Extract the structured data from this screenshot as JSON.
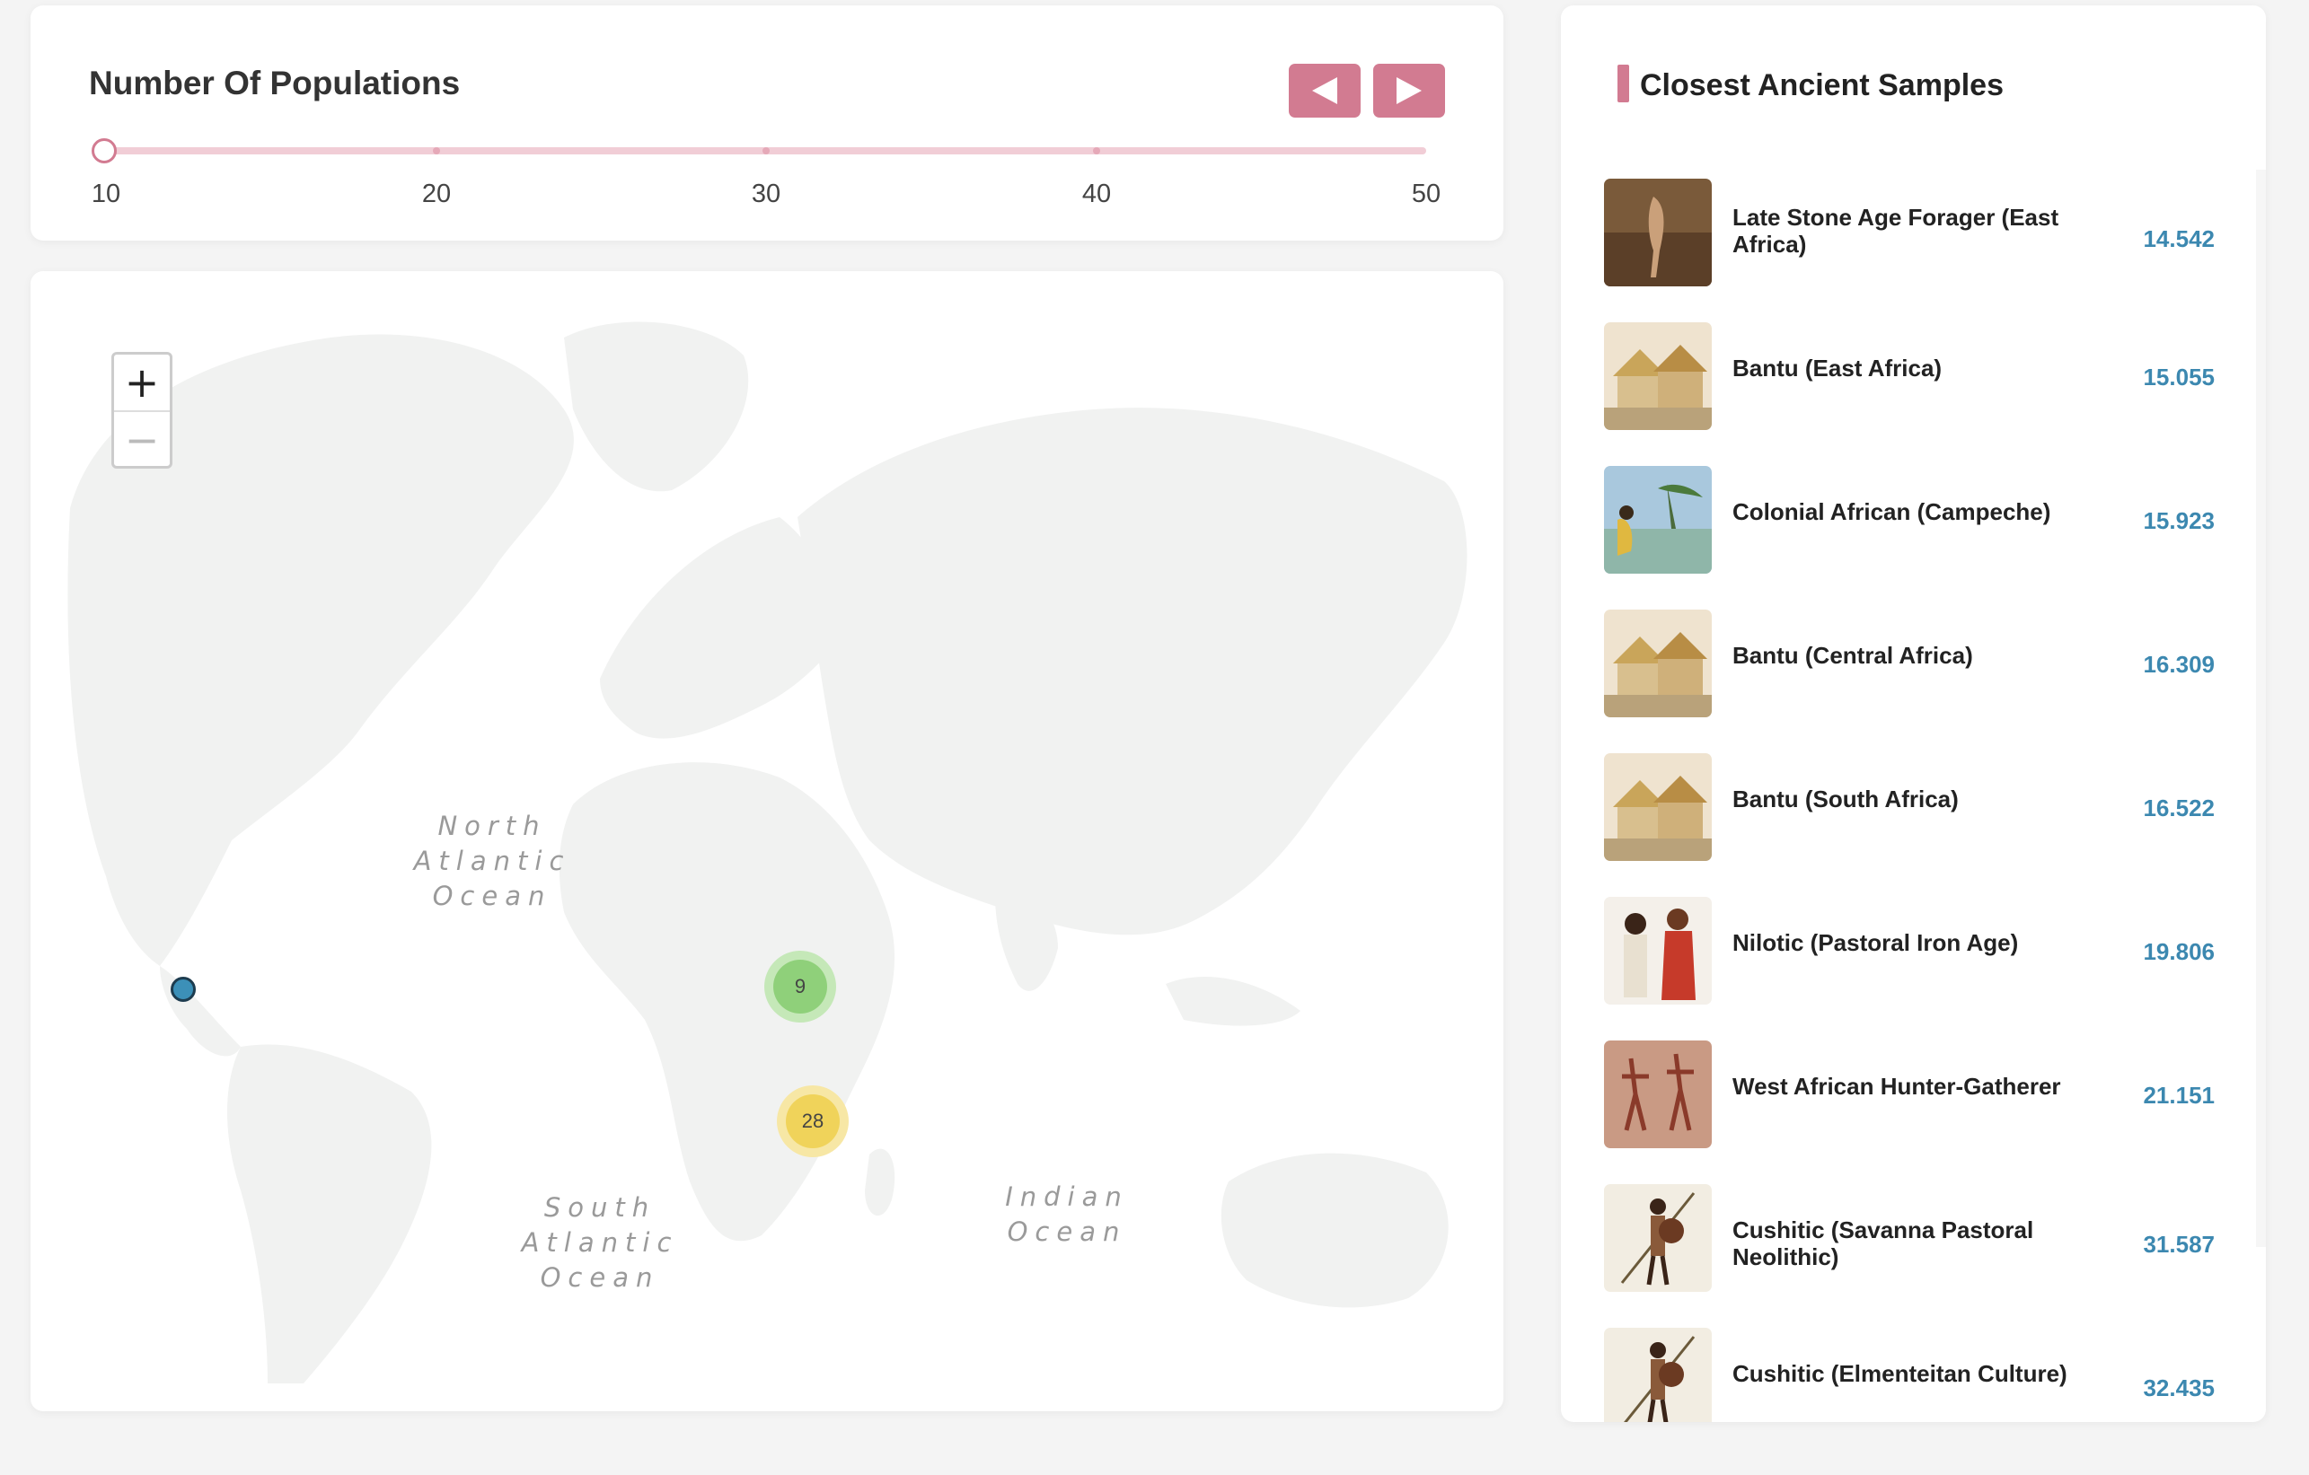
{
  "slider": {
    "title": "Number Of Populations",
    "value": 10,
    "min": 10,
    "max": 50,
    "ticks": [
      "10",
      "20",
      "30",
      "40",
      "50"
    ],
    "prev_icon": "triangle-left-icon",
    "next_icon": "triangle-right-icon"
  },
  "map": {
    "zoom_in": "+",
    "zoom_out": "−",
    "oceans": {
      "north_atlantic": "North\nAtlantic\nOcean",
      "south_atlantic": "South\nAtlantic\nOcean",
      "indian": "Indian\nOcean"
    },
    "clusters": [
      {
        "count": "9",
        "color": "#8fd07a",
        "halo": "#c5e8b8"
      },
      {
        "count": "28",
        "color": "#f0d35a",
        "halo": "#f7e7a5"
      }
    ],
    "marker_color": "#3c90b8"
  },
  "samples": {
    "title": "Closest Ancient Samples",
    "items": [
      {
        "name": "Late Stone Age Forager (East Africa)",
        "value": "14.542",
        "thumb_icon": "cave-painting-thumbnail"
      },
      {
        "name": "Bantu (East Africa)",
        "value": "15.055",
        "thumb_icon": "village-thumbnail"
      },
      {
        "name": "Colonial African (Campeche)",
        "value": "15.923",
        "thumb_icon": "coastal-scene-thumbnail"
      },
      {
        "name": "Bantu (Central Africa)",
        "value": "16.309",
        "thumb_icon": "village-thumbnail"
      },
      {
        "name": "Bantu (South Africa)",
        "value": "16.522",
        "thumb_icon": "village-thumbnail"
      },
      {
        "name": "Nilotic (Pastoral Iron Age)",
        "value": "19.806",
        "thumb_icon": "warriors-thumbnail"
      },
      {
        "name": "West African Hunter-Gatherer",
        "value": "21.151",
        "thumb_icon": "rock-art-thumbnail"
      },
      {
        "name": "Cushitic (Savanna Pastoral Neolithic)",
        "value": "31.587",
        "thumb_icon": "spearman-thumbnail"
      },
      {
        "name": "Cushitic (Elmenteitan Culture)",
        "value": "32.435",
        "thumb_icon": "spearman-thumbnail"
      }
    ]
  },
  "colors": {
    "accent": "#d27b91",
    "value_blue": "#3c88b0"
  }
}
